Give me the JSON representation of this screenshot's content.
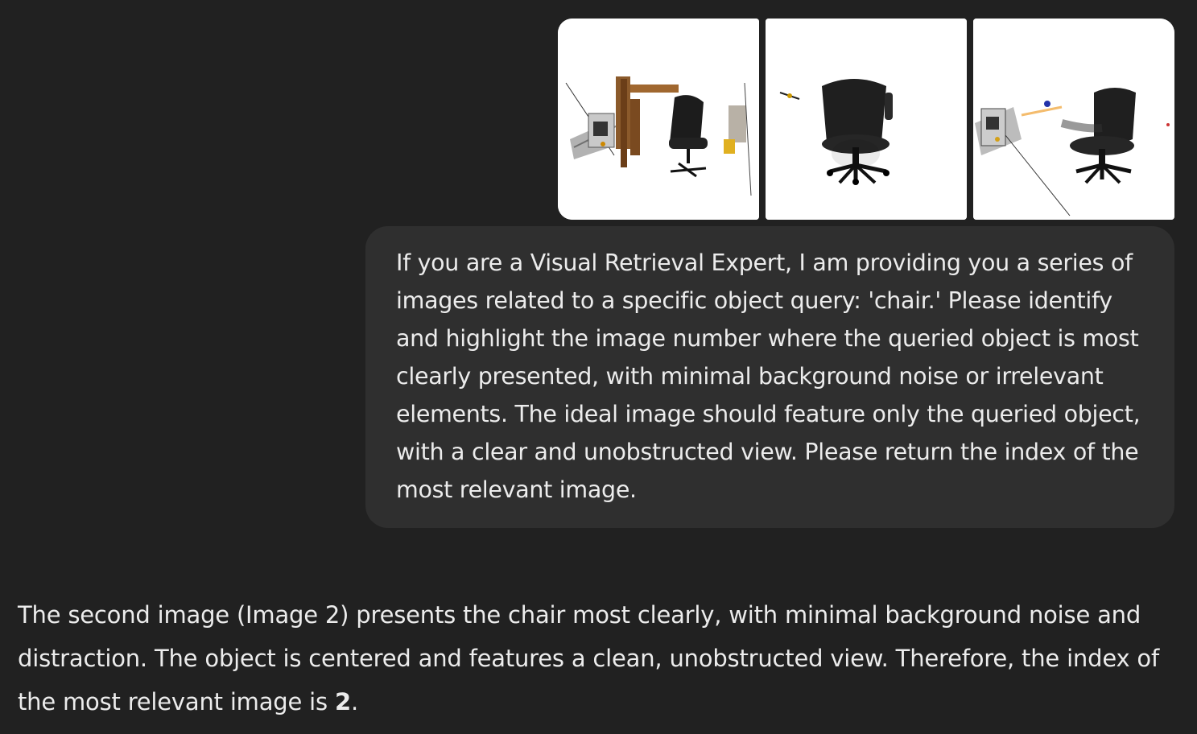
{
  "user_message": {
    "images": [
      {
        "icon": "cluttered-chair-render-icon"
      },
      {
        "icon": "isolated-chair-render-icon"
      },
      {
        "icon": "noisy-chair-render-icon"
      }
    ],
    "text": "If you are a Visual Retrieval Expert, I am providing you a series of images related to a specific object query: 'chair.' Please identify and highlight the image number where the queried object is most clearly presented, with minimal background noise or irrelevant elements. The ideal image should feature only the queried object, with a clear and unobstructed view. Please return the index of the most relevant image."
  },
  "assistant_message": {
    "text_before": "The second image (Image 2) presents the chair most clearly, with minimal background noise and distraction. The object is centered and features a clean, unobstructed view. Therefore, the index of the most relevant image is ",
    "answer": "2",
    "text_after": "."
  },
  "colors": {
    "background": "#212121",
    "user_bubble": "#2f2f2f",
    "text": "#ececec"
  }
}
